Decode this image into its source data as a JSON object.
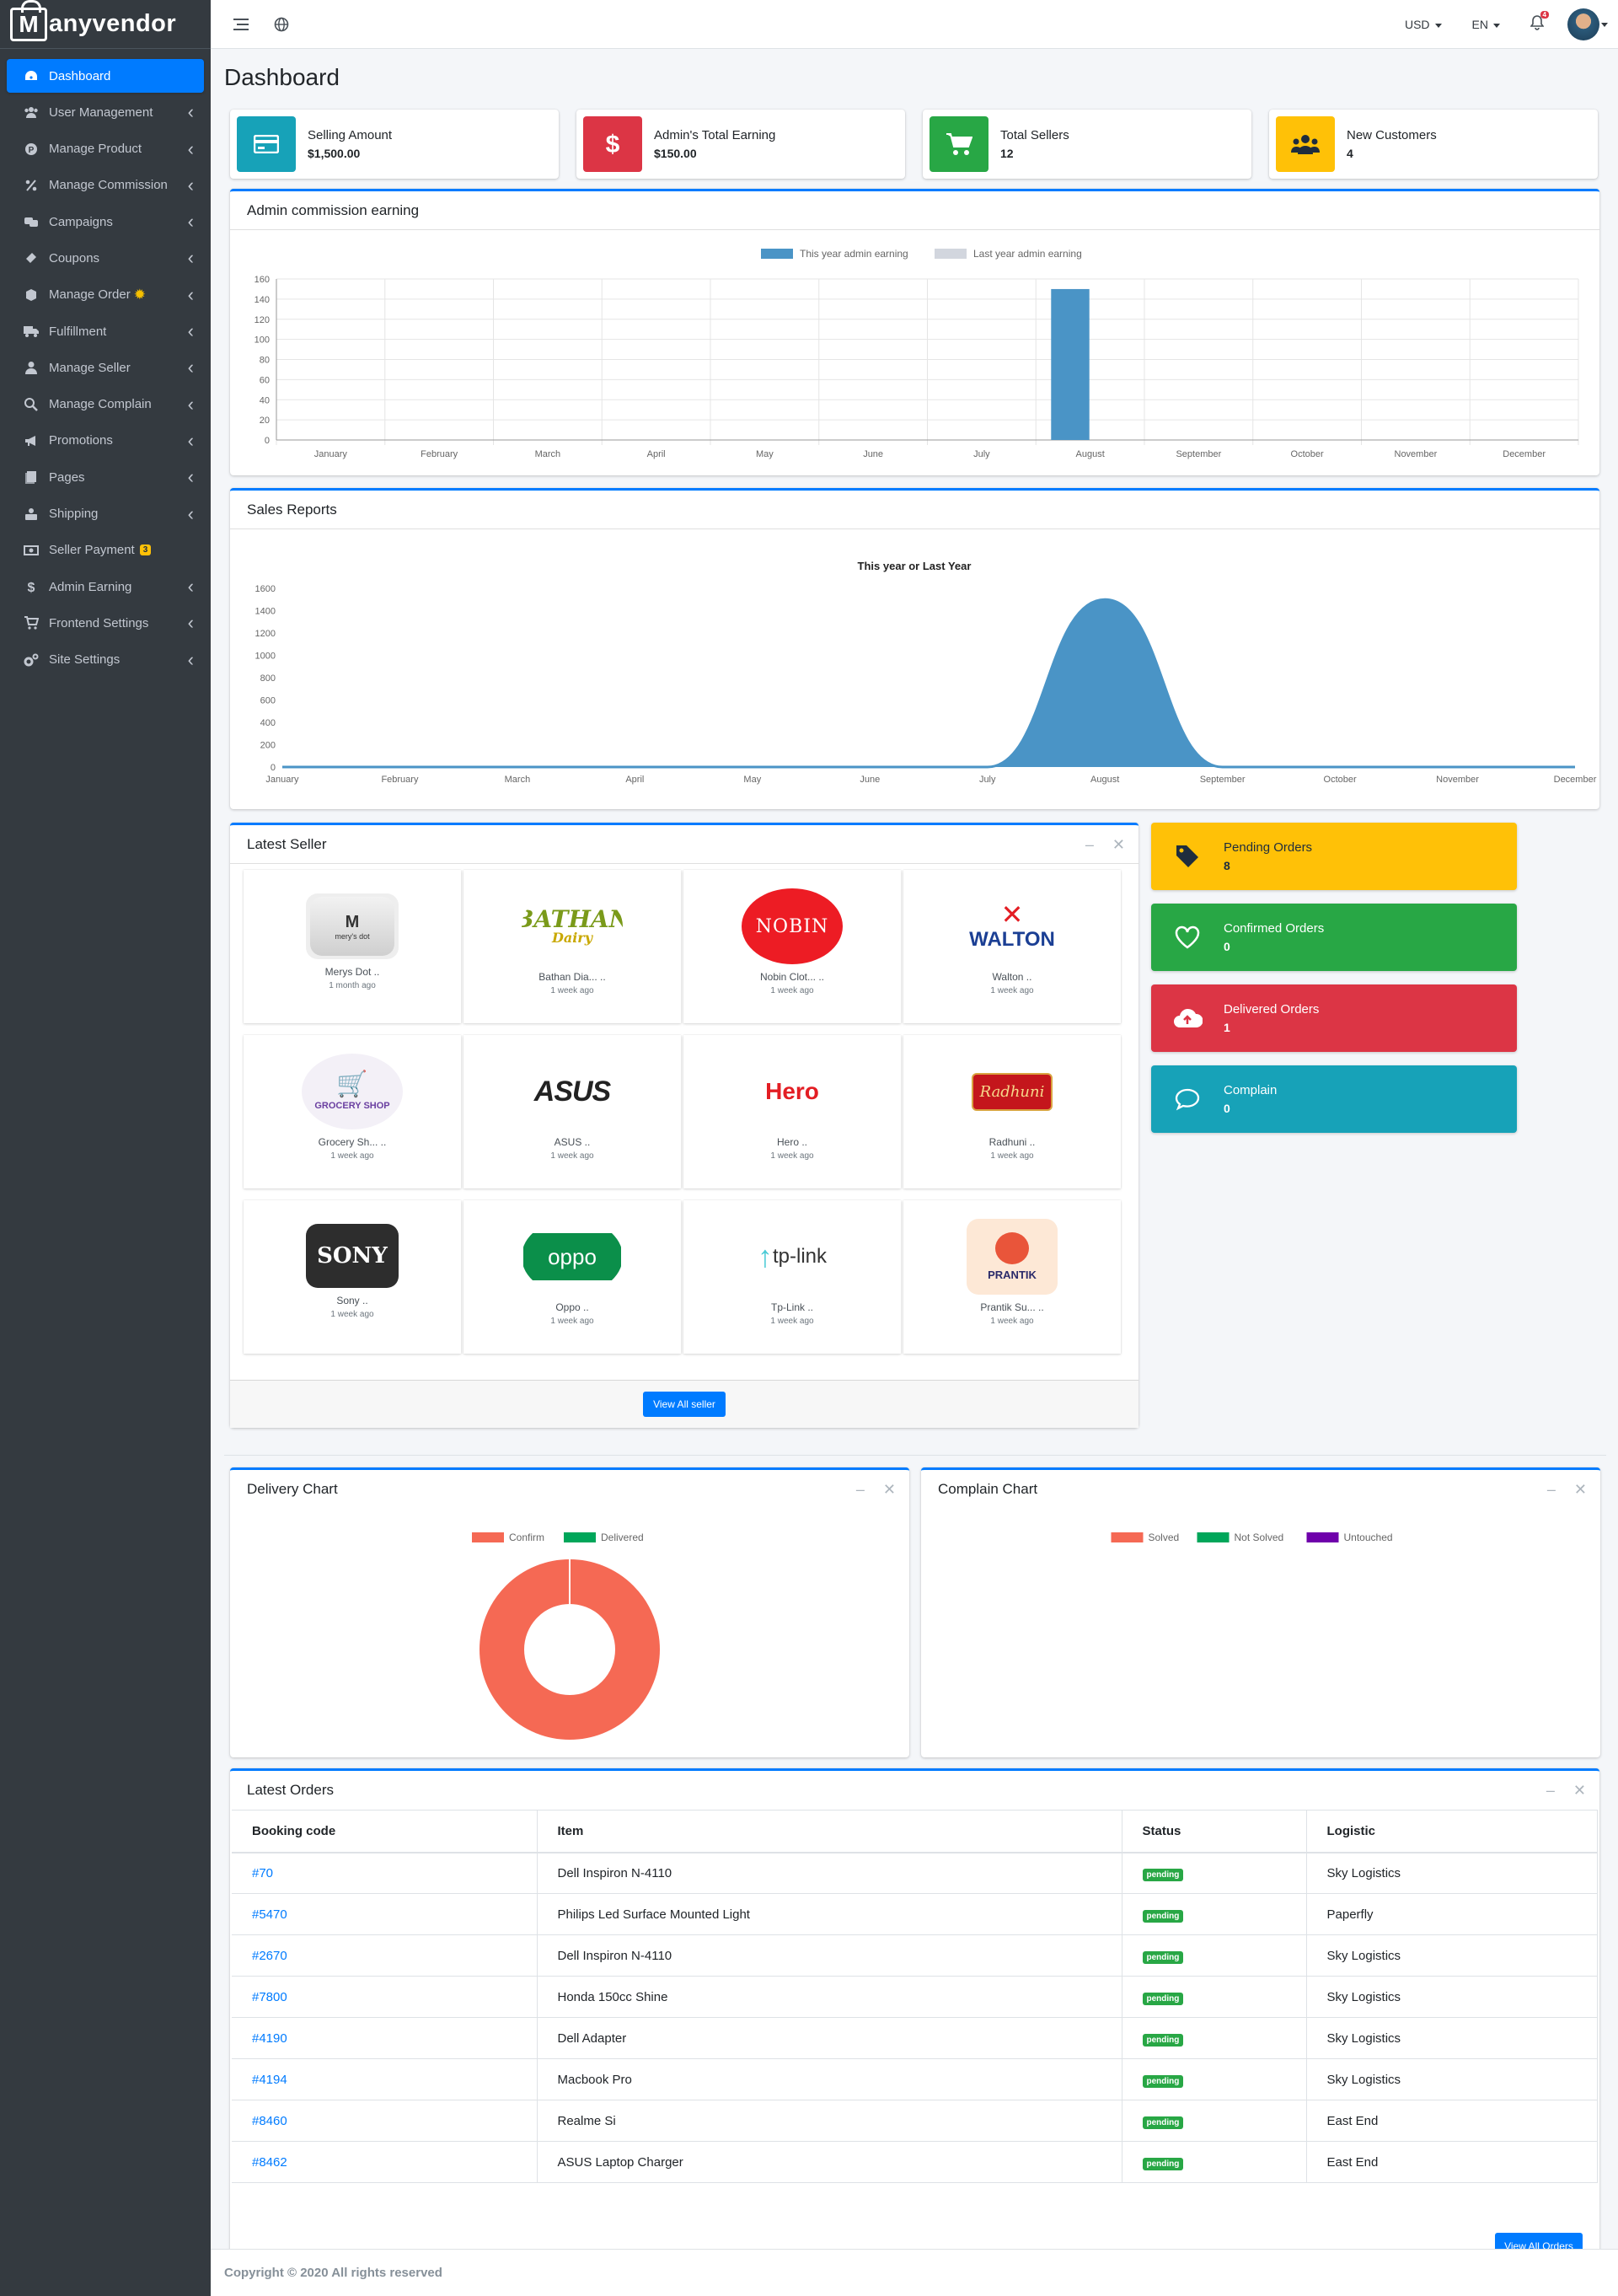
{
  "brand": {
    "name": "Manyvendor",
    "logo_letter": "M",
    "rest": "anyvendor"
  },
  "sidebar": {
    "items": [
      {
        "label": "Dashboard",
        "icon": "dashboard-icon",
        "active": true
      },
      {
        "label": "User Management",
        "icon": "users-icon"
      },
      {
        "label": "Manage Product",
        "icon": "product-icon"
      },
      {
        "label": "Manage Commission",
        "icon": "percent-icon"
      },
      {
        "label": "Campaigns",
        "icon": "campaigns-icon"
      },
      {
        "label": "Coupons",
        "icon": "ticket-icon"
      },
      {
        "label": "Manage Order",
        "icon": "order-icon"
      },
      {
        "label": "Fulfillment",
        "icon": "truck-icon"
      },
      {
        "label": "Manage Seller",
        "icon": "seller-icon"
      },
      {
        "label": "Manage Complain",
        "icon": "complain-icon"
      },
      {
        "label": "Promotions",
        "icon": "bullhorn-icon"
      },
      {
        "label": "Pages",
        "icon": "pages-icon"
      },
      {
        "label": "Shipping",
        "icon": "shipping-icon"
      },
      {
        "label": "Seller Payment",
        "icon": "money-icon",
        "badge": "3"
      },
      {
        "label": "Admin Earning",
        "icon": "dollar-icon"
      },
      {
        "label": "Frontend Settings",
        "icon": "cart-icon"
      },
      {
        "label": "Site Settings",
        "icon": "cogs-icon"
      }
    ]
  },
  "topbar": {
    "currency": "USD",
    "language": "EN",
    "notifications": "4"
  },
  "page": {
    "title": "Dashboard"
  },
  "info_boxes": [
    {
      "label": "Selling Amount",
      "value": "$1,500.00",
      "color": "#17a2b8"
    },
    {
      "label": "Admin's Total Earning",
      "value": "$150.00",
      "color": "#dc3545"
    },
    {
      "label": "Total Sellers",
      "value": "12",
      "color": "#28a745"
    },
    {
      "label": "New Customers",
      "value": "4",
      "color": "#ffc107"
    }
  ],
  "commission_card": {
    "title": "Admin commission earning"
  },
  "sales_card": {
    "title": "Sales Reports"
  },
  "chart_data": [
    {
      "type": "bar",
      "title": "",
      "categories": [
        "January",
        "February",
        "March",
        "April",
        "May",
        "June",
        "July",
        "August",
        "September",
        "October",
        "November",
        "December"
      ],
      "series": [
        {
          "name": "This year admin earning",
          "color": "#4a94c6",
          "values": [
            0,
            0,
            0,
            0,
            0,
            0,
            0,
            150,
            0,
            0,
            0,
            0
          ]
        },
        {
          "name": "Last year admin earning",
          "color": "#d2d6de",
          "values": [
            0,
            0,
            0,
            0,
            0,
            0,
            0,
            0,
            0,
            0,
            0,
            0
          ]
        }
      ],
      "ylim": [
        0,
        160
      ],
      "yticks": [
        0,
        20,
        40,
        60,
        80,
        100,
        120,
        140,
        160
      ],
      "grid": true,
      "legend": "top"
    },
    {
      "type": "area",
      "title": "This year or Last Year",
      "categories": [
        "January",
        "February",
        "March",
        "April",
        "May",
        "June",
        "July",
        "August",
        "September",
        "October",
        "November",
        "December"
      ],
      "series": [
        {
          "name": "",
          "color": "#4a94c6",
          "values": [
            0,
            0,
            0,
            0,
            0,
            0,
            0,
            1500,
            0,
            0,
            0,
            0
          ]
        }
      ],
      "ylim": [
        0,
        1600
      ],
      "yticks": [
        0,
        200,
        400,
        600,
        800,
        1000,
        1200,
        1400,
        1600
      ],
      "grid": false
    },
    {
      "type": "pie",
      "title": "",
      "categories": [
        "Confirm",
        "Delivered"
      ],
      "colors": [
        "#f56954",
        "#00a65a"
      ],
      "values": [
        8,
        0
      ],
      "legend": "top"
    },
    {
      "type": "pie",
      "title": "",
      "categories": [
        "Solved",
        "Not Solved",
        "Untouched"
      ],
      "colors": [
        "#f56954",
        "#00a65a",
        "#6f00ab"
      ],
      "values": [
        0,
        0,
        0
      ],
      "legend": "top"
    }
  ],
  "latest_seller": {
    "title": "Latest Seller",
    "view_all": "View All seller",
    "sellers": [
      {
        "name": "Merys Dot ..",
        "time": "1 month ago"
      },
      {
        "name": "Bathan Dia... ..",
        "time": "1 week ago"
      },
      {
        "name": "Nobin Clot... ..",
        "time": "1 week ago"
      },
      {
        "name": "Walton ..",
        "time": "1 week ago"
      },
      {
        "name": "Grocery Sh... ..",
        "time": "1 week ago"
      },
      {
        "name": "ASUS ..",
        "time": "1 week ago"
      },
      {
        "name": "Hero ..",
        "time": "1 week ago"
      },
      {
        "name": "Radhuni ..",
        "time": "1 week ago"
      },
      {
        "name": "Sony ..",
        "time": "1 week ago"
      },
      {
        "name": "Oppo ..",
        "time": "1 week ago"
      },
      {
        "name": "Tp-Link ..",
        "time": "1 week ago"
      },
      {
        "name": "Prantik Su... ..",
        "time": "1 week ago"
      }
    ],
    "logos": {
      "merys": "mery's dot",
      "bathan": "BATHAN",
      "bathan2": "Dairy",
      "nobin": "NOBIN",
      "walton": "WALTON",
      "grocery": "GROCERY SHOP",
      "asus": "ASUS",
      "hero": "Hero",
      "radhuni": "Radhuni",
      "sony": "SONY",
      "oppo": "oppo",
      "tplink": "tp-link",
      "prantik": "PRANTIK"
    }
  },
  "order_stats": [
    {
      "label": "Pending Orders",
      "value": "8",
      "color": "#ffc107",
      "text_color": "#1f2d3d"
    },
    {
      "label": "Confirmed Orders",
      "value": "0",
      "color": "#28a745",
      "text_color": "#ffffff"
    },
    {
      "label": "Delivered Orders",
      "value": "1",
      "color": "#dc3545",
      "text_color": "#ffffff"
    },
    {
      "label": "Complain",
      "value": "0",
      "color": "#17a2b8",
      "text_color": "#ffffff"
    }
  ],
  "delivery_chart": {
    "title": "Delivery Chart"
  },
  "complain_chart": {
    "title": "Complain Chart"
  },
  "latest_orders": {
    "title": "Latest Orders",
    "columns": [
      "Booking code",
      "Item",
      "Status",
      "Logistic"
    ],
    "rows": [
      {
        "code": "#70",
        "item": "Dell Inspiron N-4110",
        "status": "pending",
        "logistic": "Sky Logistics"
      },
      {
        "code": "#5470",
        "item": "Philips Led Surface Mounted Light",
        "status": "pending",
        "logistic": "Paperfly"
      },
      {
        "code": "#2670",
        "item": "Dell Inspiron N-4110",
        "status": "pending",
        "logistic": "Sky Logistics"
      },
      {
        "code": "#7800",
        "item": "Honda 150cc Shine",
        "status": "pending",
        "logistic": "Sky Logistics"
      },
      {
        "code": "#4190",
        "item": "Dell Adapter",
        "status": "pending",
        "logistic": "Sky Logistics"
      },
      {
        "code": "#4194",
        "item": "Macbook Pro",
        "status": "pending",
        "logistic": "Sky Logistics"
      },
      {
        "code": "#8460",
        "item": "Realme Si",
        "status": "pending",
        "logistic": "East End"
      },
      {
        "code": "#8462",
        "item": "ASUS Laptop Charger",
        "status": "pending",
        "logistic": "East End"
      }
    ],
    "view_all": "View All Orders"
  },
  "footer": {
    "text": "Copyright © 2020 All rights reserved"
  }
}
